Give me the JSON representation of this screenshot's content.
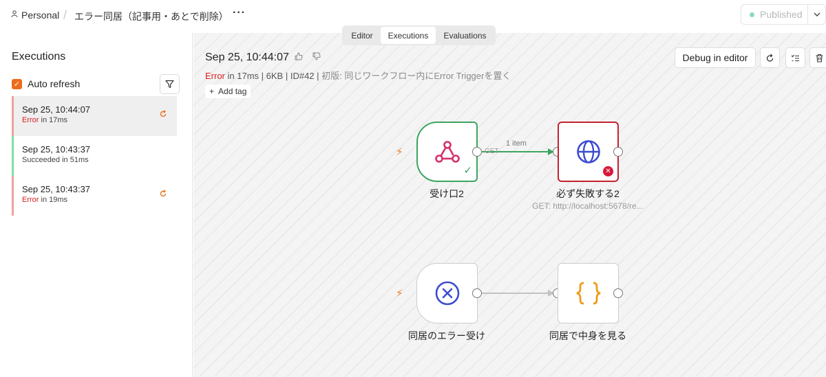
{
  "breadcrumb": {
    "user": "Personal",
    "workflow": "エラー同居（記事用・あとで削除）",
    "more": "···"
  },
  "publish": {
    "label": "Published"
  },
  "tabs": [
    {
      "label": "Editor"
    },
    {
      "label": "Executions"
    },
    {
      "label": "Evaluations"
    }
  ],
  "sidebar": {
    "title": "Executions",
    "auto_refresh": "Auto refresh",
    "items": [
      {
        "date": "Sep 25, 10:44:07",
        "status": "Error",
        "duration": "in 17ms"
      },
      {
        "date": "Sep 25, 10:43:37",
        "status": "Succeeded",
        "duration": "in 51ms"
      },
      {
        "date": "Sep 25, 10:43:37",
        "status": "Error",
        "duration": "in 19ms"
      }
    ]
  },
  "execution": {
    "date": "Sep 25, 10:44:07",
    "status": "Error",
    "duration": "in 17ms",
    "size": "6KB",
    "id": "ID#42",
    "note": "初版: 同じワークフロー内にError Triggerを置く",
    "add_tag": "Add tag",
    "debug": "Debug in editor"
  },
  "nodes": [
    {
      "label": "受け口2",
      "icon": "webhook-icon"
    },
    {
      "label": "必ず失敗する2",
      "subtitle": "GET: http://localhost:5678/re...",
      "icon": "globe-icon"
    },
    {
      "label": "同居のエラー受け",
      "icon": "error-trigger-icon"
    },
    {
      "label": "同居で中身を見る",
      "icon": "code-braces-icon"
    }
  ],
  "edges": {
    "items_label": "1 item",
    "method_label": "GET"
  },
  "colors": {
    "accent": "#ec6c1e",
    "error": "#d92020",
    "success": "#3aa55e"
  }
}
